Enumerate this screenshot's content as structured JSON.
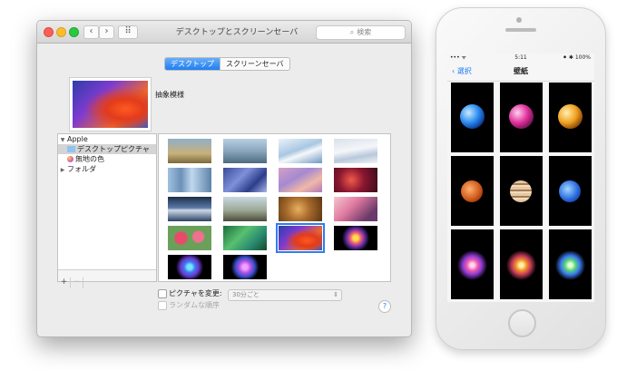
{
  "mac": {
    "window_title": "デスクトップとスクリーンセーバ",
    "search_placeholder": "検索",
    "nav": {
      "back": "‹",
      "forward": "›",
      "grid": "⠿"
    },
    "tabs": [
      {
        "label": "デスクトップ",
        "active": true
      },
      {
        "label": "スクリーンセーバ",
        "active": false
      }
    ],
    "current_picture_name": "抽象模様",
    "sidebar": {
      "items": [
        {
          "label": "Apple",
          "toggle": "▼",
          "selected": false
        },
        {
          "label": "デスクトップピクチャ",
          "selected": true,
          "color": "#8fc3f0"
        },
        {
          "label": "無地の色",
          "selected": false,
          "color": "#e05fa0"
        },
        {
          "label": "フォルダ",
          "toggle": "▶",
          "selected": false
        }
      ],
      "add": "+",
      "remove": "−"
    },
    "change_picture_label": "ピクチャを変更:",
    "interval": "30分ごと",
    "random_label": "ランダムな順序",
    "help": "?"
  },
  "iphone": {
    "time": "5:11",
    "signal": "••• ᯤ",
    "battery": "⚫ ✱ 100%",
    "back_label": "選択",
    "title": "壁紙"
  }
}
